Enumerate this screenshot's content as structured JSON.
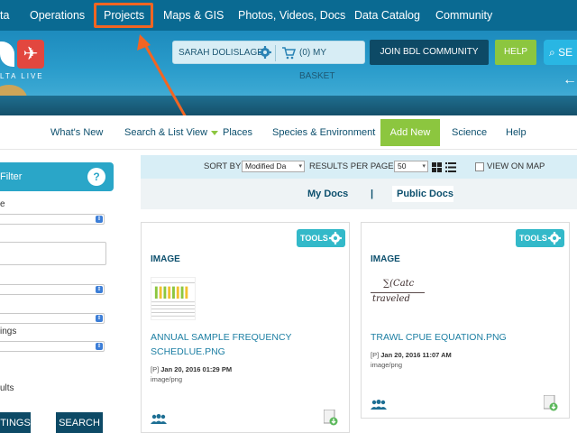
{
  "topnav": {
    "items": [
      "ta",
      "Operations",
      "Projects",
      "Maps & GIS",
      "Photos, Videos, Docs",
      "Data Catalog",
      "Community"
    ]
  },
  "banner": {
    "logo_text": "LTA LIVE",
    "user_name": "SARAH DOLISLAGER",
    "basket_label": "(0) MY BASKET",
    "join_label": "JOIN BDL COMMUNITY",
    "help_label": "HELP",
    "search_label": "SE"
  },
  "subnav": {
    "items": [
      "What's New",
      "Search & List View",
      "Places",
      "Species & Environment",
      "Add New",
      "Science",
      "Help"
    ]
  },
  "filter": {
    "title": "Filter",
    "help_symbol": "?",
    "label_e": "e",
    "label_ings": "ings",
    "label_ults": "ults",
    "settings_label": "TINGS",
    "search_label": "SEARCH"
  },
  "sortbar": {
    "sort_by_label": "SORT BY",
    "sort_value": "Modified Da",
    "results_label": "RESULTS PER PAGE",
    "results_value": "50",
    "view_on_map_label": "VIEW ON MAP"
  },
  "doctabs": {
    "my_docs": "My Docs",
    "separator": "|",
    "public_docs": "Public Docs"
  },
  "cards": [
    {
      "tools_label": "TOOLS",
      "kind": "IMAGE",
      "title": "ANNUAL SAMPLE FREQUENCY SCHEDLUE.PNG",
      "meta_prefix": "[P]",
      "date": "Jan 20, 2016 01:29 PM",
      "mime": "image/png"
    },
    {
      "tools_label": "TOOLS",
      "kind": "IMAGE",
      "title": "TRAWL CPUE EQUATION.PNG",
      "meta_prefix": "[P]",
      "date": "Jan 20, 2016 11:07 AM",
      "mime": "image/png",
      "formula_num": "∑(Catc",
      "formula_den": "traveled"
    }
  ],
  "colors": {
    "topnav": "#0a6a92",
    "highlight": "#f26522",
    "accent_green": "#8cc63f",
    "dark_teal": "#0d4a66",
    "tools": "#33b9c9"
  }
}
